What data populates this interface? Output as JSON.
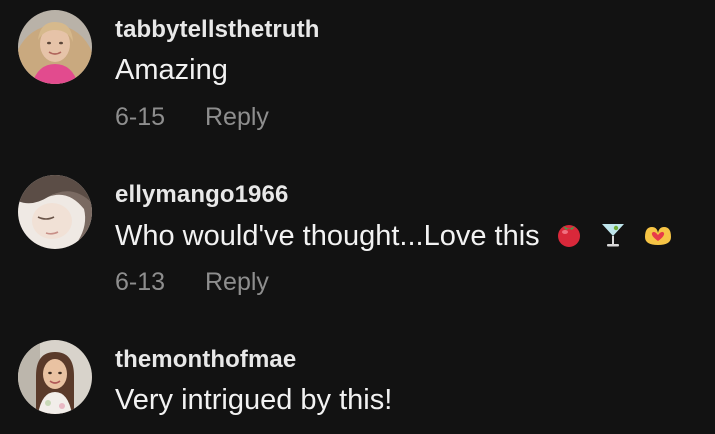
{
  "comments": [
    {
      "username": "tabbytellsthetruth",
      "text": "Amazing",
      "date": "6-15",
      "reply_label": "Reply"
    },
    {
      "username": "ellymango1966",
      "text": "Who would've thought...Love this",
      "emojis": [
        "tomato-icon",
        "cocktail-glass-icon",
        "heart-hands-icon"
      ],
      "date": "6-13",
      "reply_label": "Reply"
    },
    {
      "username": "themonthofmae",
      "text": "Very intrigued by this!"
    }
  ]
}
